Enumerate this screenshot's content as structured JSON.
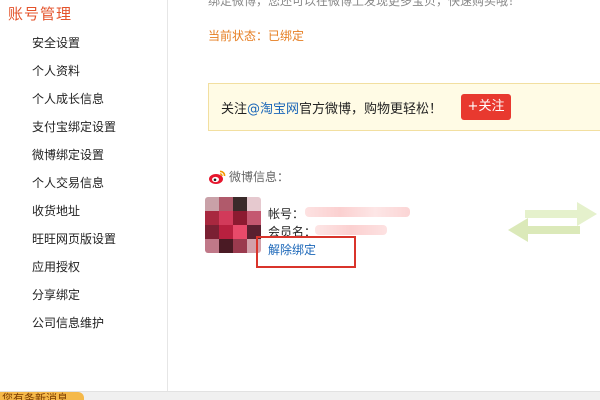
{
  "sidebar": {
    "title": "账号管理",
    "items": [
      {
        "label": "安全设置"
      },
      {
        "label": "个人资料"
      },
      {
        "label": "个人成长信息"
      },
      {
        "label": "支付宝绑定设置"
      },
      {
        "label": "微博绑定设置"
      },
      {
        "label": "个人交易信息"
      },
      {
        "label": "收货地址"
      },
      {
        "label": "旺旺网页版设置"
      },
      {
        "label": "应用授权"
      },
      {
        "label": "分享绑定"
      },
      {
        "label": "公司信息维护"
      }
    ]
  },
  "main": {
    "top_cut_text": "绑定微博，您还可以在微博上发现更多宝贝，快速购买哦！",
    "status_text": "当前状态：已绑定",
    "follow": {
      "prefix": "关注",
      "link": "@淘宝网",
      "suffix": "官方微博，购物更轻松！",
      "button": "+关注"
    },
    "weibo_info_title": "微博信息：",
    "account_label": "帐号：",
    "member_label": "会员名：",
    "unbind_label": "解除绑定"
  },
  "bottom_badge_text": "您有条新消息",
  "icons": {
    "weibo": "weibo-icon",
    "sync": "sync-arrows-icon"
  },
  "colors": {
    "accent_orange": "#e4532b",
    "status_orange": "#e67e22",
    "link_blue": "#1a66b8",
    "follow_red": "#e8392f",
    "highlight_red": "#d9342b"
  }
}
